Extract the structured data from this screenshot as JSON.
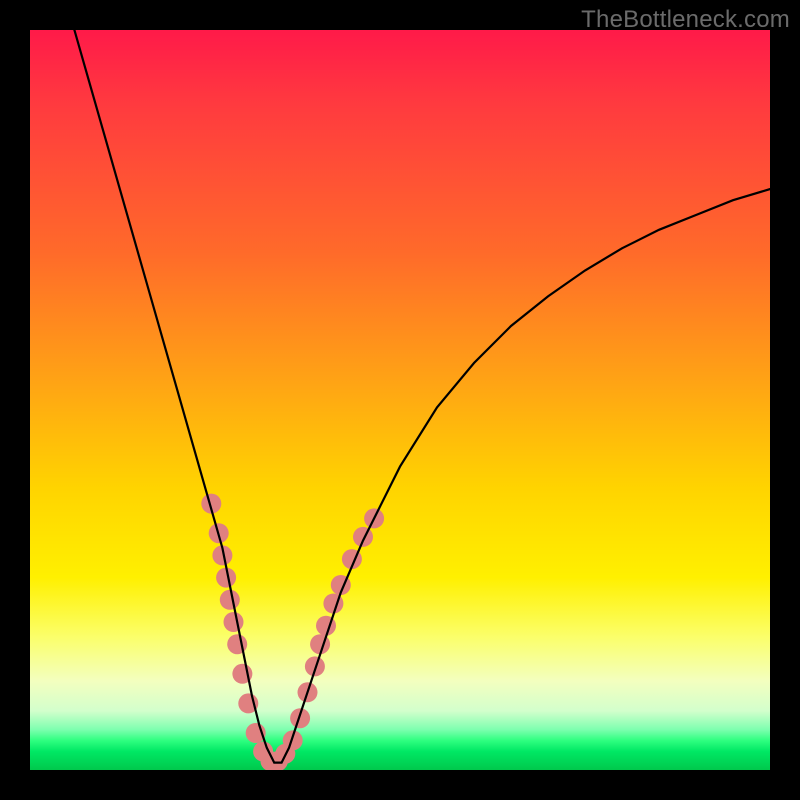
{
  "watermark": "TheBottleneck.com",
  "chart_data": {
    "type": "line",
    "title": "",
    "xlabel": "",
    "ylabel": "",
    "xlim": [
      0,
      100
    ],
    "ylim": [
      0,
      100
    ],
    "series": [
      {
        "name": "bottleneck-curve",
        "x": [
          6,
          8,
          10,
          12,
          14,
          16,
          18,
          20,
          22,
          24,
          26,
          27,
          28,
          29,
          30,
          31,
          32,
          33,
          34,
          35,
          36,
          38,
          40,
          42,
          45,
          50,
          55,
          60,
          65,
          70,
          75,
          80,
          85,
          90,
          95,
          100
        ],
        "y": [
          100,
          93,
          86,
          79,
          72,
          65,
          58,
          51,
          44,
          37,
          30,
          25,
          20,
          15,
          10,
          6,
          3,
          1,
          1,
          3,
          6,
          12,
          18,
          24,
          31,
          41,
          49,
          55,
          60,
          64,
          67.5,
          70.5,
          73,
          75,
          77,
          78.5
        ]
      }
    ],
    "markers": {
      "name": "highlight-beads",
      "points": [
        {
          "x": 24.5,
          "y": 36
        },
        {
          "x": 25.5,
          "y": 32
        },
        {
          "x": 26.0,
          "y": 29
        },
        {
          "x": 26.5,
          "y": 26
        },
        {
          "x": 27.0,
          "y": 23
        },
        {
          "x": 27.5,
          "y": 20
        },
        {
          "x": 28.0,
          "y": 17
        },
        {
          "x": 28.7,
          "y": 13
        },
        {
          "x": 29.5,
          "y": 9
        },
        {
          "x": 30.5,
          "y": 5
        },
        {
          "x": 31.5,
          "y": 2.5
        },
        {
          "x": 32.5,
          "y": 1.2
        },
        {
          "x": 33.5,
          "y": 1.2
        },
        {
          "x": 34.5,
          "y": 2.2
        },
        {
          "x": 35.5,
          "y": 4.0
        },
        {
          "x": 36.5,
          "y": 7.0
        },
        {
          "x": 37.5,
          "y": 10.5
        },
        {
          "x": 38.5,
          "y": 14.0
        },
        {
          "x": 39.2,
          "y": 17.0
        },
        {
          "x": 40.0,
          "y": 19.5
        },
        {
          "x": 41.0,
          "y": 22.5
        },
        {
          "x": 42.0,
          "y": 25.0
        },
        {
          "x": 43.5,
          "y": 28.5
        },
        {
          "x": 45.0,
          "y": 31.5
        },
        {
          "x": 46.5,
          "y": 34.0
        }
      ],
      "color": "#e08080",
      "radius_px": 10
    },
    "gradient_stops": [
      {
        "pos": 0,
        "color": "#ff1a49"
      },
      {
        "pos": 0.62,
        "color": "#ffd400"
      },
      {
        "pos": 0.96,
        "color": "#2fff80"
      },
      {
        "pos": 1.0,
        "color": "#00c84c"
      }
    ]
  }
}
